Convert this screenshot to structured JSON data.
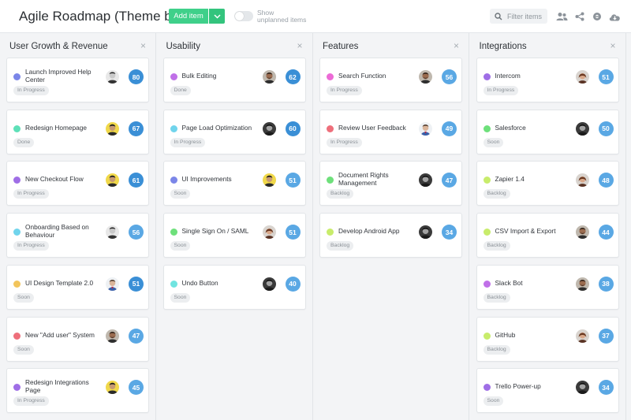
{
  "header": {
    "title": "Agile Roadmap (Theme based)",
    "add_item_label": "Add item",
    "toggle_label_line1": "Show",
    "toggle_label_line2": "unplanned items",
    "filter_placeholder": "Filter items",
    "icons": [
      "chevron-down-icon",
      "search-icon",
      "users-icon",
      "share-icon",
      "settings-icon",
      "cloud-download-icon"
    ]
  },
  "colors": {
    "accent_green": "#3fd08a",
    "score_dark": "#3a8fd6",
    "score_light": "#5aa8e4",
    "dot_blue": "#7b86e8",
    "dot_purple": "#9f6ee6",
    "dot_teal": "#5ee0b8",
    "dot_cyan": "#70d4ec",
    "dot_yellow": "#f2c55c",
    "dot_red": "#ee6f7b",
    "dot_pink": "#ec6bd6",
    "dot_green": "#6ee07b",
    "dot_lime": "#c8ec6b"
  },
  "columns": [
    {
      "title": "User Growth & Revenue",
      "close": "×",
      "cards": [
        {
          "title": "Launch Improved Help Center",
          "status": "In Progress",
          "score": "80",
          "dot": "#7b86e8",
          "avatar": "a1",
          "dark": true
        },
        {
          "title": "Redesign Homepage",
          "status": "Done",
          "score": "67",
          "dot": "#5ee0b8",
          "avatar": "a2",
          "dark": true
        },
        {
          "title": "New Checkout Flow",
          "status": "In Progress",
          "score": "61",
          "dot": "#9f6ee6",
          "avatar": "a2",
          "dark": true
        },
        {
          "title": "Onboarding Based on Behaviour",
          "status": "In Progress",
          "score": "56",
          "dot": "#70d4ec",
          "avatar": "a1",
          "dark": false
        },
        {
          "title": "UI Design Template 2.0",
          "status": "Soon",
          "score": "51",
          "dot": "#f2c55c",
          "avatar": "a3",
          "dark": true
        },
        {
          "title": "New \"Add user\" System",
          "status": "Soon",
          "score": "47",
          "dot": "#ee6f7b",
          "avatar": "a4",
          "dark": false
        },
        {
          "title": "Redesign Integrations Page",
          "status": "In Progress",
          "score": "45",
          "dot": "#9f6ee6",
          "avatar": "a2",
          "dark": false
        }
      ]
    },
    {
      "title": "Usability",
      "close": "×",
      "cards": [
        {
          "title": "Bulk Editing",
          "status": "Done",
          "score": "62",
          "dot": "#c070e8",
          "avatar": "a4",
          "dark": true
        },
        {
          "title": "Page Load Optimization",
          "status": "In Progress",
          "score": "60",
          "dot": "#70d4ec",
          "avatar": "a5",
          "dark": true
        },
        {
          "title": "UI Improvements",
          "status": "Soon",
          "score": "51",
          "dot": "#7b86e8",
          "avatar": "a2",
          "dark": false
        },
        {
          "title": "Single Sign On / SAML",
          "status": "Soon",
          "score": "51",
          "dot": "#6ee07b",
          "avatar": "a6",
          "dark": false
        },
        {
          "title": "Undo Button",
          "status": "Soon",
          "score": "40",
          "dot": "#70e4e0",
          "avatar": "a5",
          "dark": false
        }
      ]
    },
    {
      "title": "Features",
      "close": "×",
      "cards": [
        {
          "title": "Search Function",
          "status": "In Progress",
          "score": "56",
          "dot": "#ec6bd6",
          "avatar": "a4",
          "dark": false
        },
        {
          "title": "Review User Feedback",
          "status": "In Progress",
          "score": "49",
          "dot": "#ee6f7b",
          "avatar": "a3",
          "dark": false
        },
        {
          "title": "Document Rights Management",
          "status": "Backlog",
          "score": "47",
          "dot": "#6ee07b",
          "avatar": "a5",
          "dark": false
        },
        {
          "title": "Develop Android App",
          "status": "Backlog",
          "score": "34",
          "dot": "#c8ec6b",
          "avatar": "a5",
          "dark": false
        }
      ]
    },
    {
      "title": "Integrations",
      "close": "×",
      "cards": [
        {
          "title": "Intercom",
          "status": "In Progress",
          "score": "51",
          "dot": "#9f6ee6",
          "avatar": "a6",
          "dark": false
        },
        {
          "title": "Salesforce",
          "status": "Soon",
          "score": "50",
          "dot": "#6ee07b",
          "avatar": "a5",
          "dark": false
        },
        {
          "title": "Zapier 1.4",
          "status": "Backlog",
          "score": "48",
          "dot": "#c8ec6b",
          "avatar": "a6",
          "dark": false
        },
        {
          "title": "CSV Import & Export",
          "status": "Backlog",
          "score": "44",
          "dot": "#c8ec6b",
          "avatar": "a4",
          "dark": false
        },
        {
          "title": "Slack Bot",
          "status": "Backlog",
          "score": "38",
          "dot": "#c070e8",
          "avatar": "a4",
          "dark": false
        },
        {
          "title": "GitHub",
          "status": "Backlog",
          "score": "37",
          "dot": "#c8ec6b",
          "avatar": "a6",
          "dark": false
        },
        {
          "title": "Trello Power-up",
          "status": "Soon",
          "score": "34",
          "dot": "#9f6ee6",
          "avatar": "a5",
          "dark": false
        }
      ]
    }
  ]
}
